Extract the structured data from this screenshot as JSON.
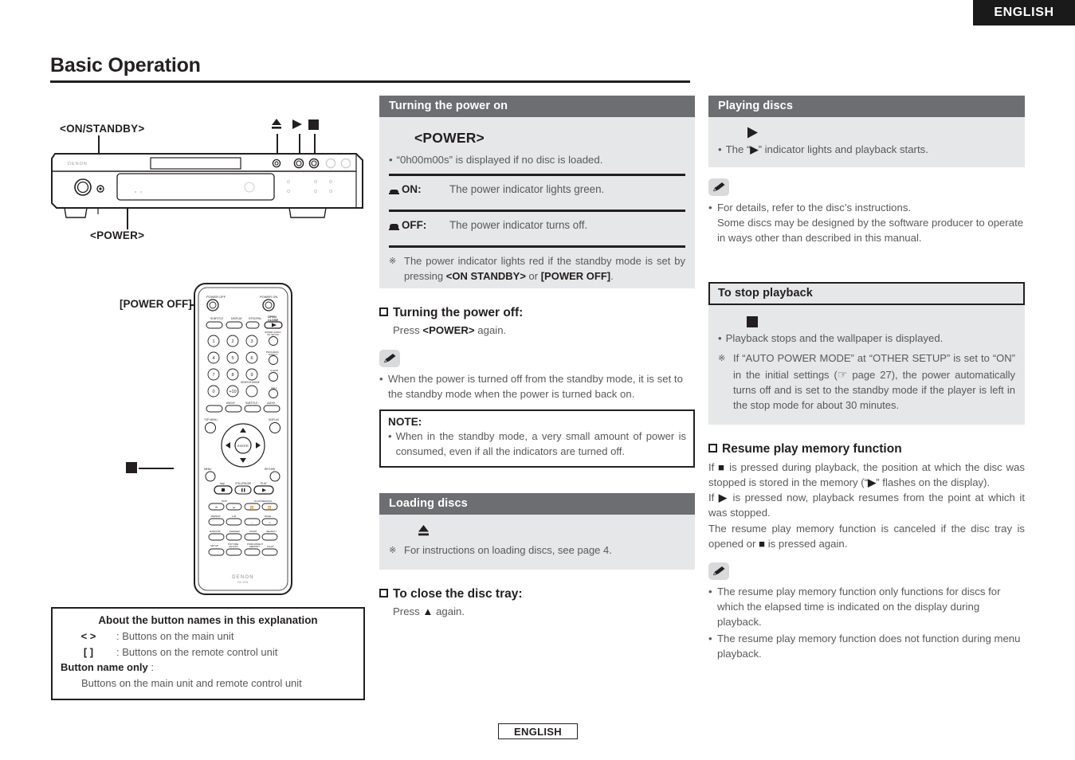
{
  "language_tab": "ENGLISH",
  "footer_tab": "ENGLISH",
  "page_title": "Basic Operation",
  "diagram": {
    "main_unit": {
      "label_on_standby": "<ON/STANDBY>",
      "label_power": "<POWER>",
      "symbol_eject": "eject-icon",
      "symbol_play": "play-icon",
      "symbol_stop": "stop-icon",
      "brand": "DENON"
    },
    "remote": {
      "label_power_off": "[POWER OFF]",
      "label_eject": "eject-icon",
      "label_stop": "stop-icon",
      "label_play": "play-icon",
      "brand": "DENON",
      "model": "RC-1011",
      "top_left_button": "POWER OFF",
      "top_right_button": "POWER ON",
      "row_labels": [
        "SUBTITLE",
        "DISPLAY",
        "NTSC/PAL",
        "OPEN CLOSE"
      ],
      "keypad": [
        "1",
        "2",
        "3",
        "4",
        "5",
        "6",
        "7",
        "8",
        "9",
        "0",
        "+10"
      ],
      "enter_label": "ENTER",
      "transport": [
        "STOP",
        "STILL/PAUSE",
        "PLAY"
      ]
    }
  },
  "middle": {
    "power_on": {
      "header": "Turning the power on",
      "button": "<POWER>",
      "bullet": "“0h00m00s” is displayed if no disc is loaded.",
      "rows": [
        {
          "icon": "button-pressed-icon",
          "key": "ON:",
          "value": "The power indicator lights green."
        },
        {
          "icon": "button-raised-icon",
          "key": "OFF:",
          "value": "The power indicator turns off."
        }
      ],
      "note_pre": "The power indicator lights red if the standby mode is set by pressing ",
      "note_b1": "<ON STANDBY>",
      "note_mid": " or ",
      "note_b2": "[POWER OFF]",
      "note_end": "."
    },
    "power_off": {
      "heading": "Turning the power off:",
      "press_pre": "Press ",
      "press_bold": "<POWER>",
      "press_post": " again.",
      "pencil_note": "When the power is turned off from the standby mode, it is set to the standby mode when the power is turned back on.",
      "note_title": "NOTE:",
      "note_text": "When in the standby mode, a very small amount of power is consumed, even if all the indicators are turned off."
    },
    "loading": {
      "header": "Loading discs",
      "symbol": "eject-icon",
      "note": "For instructions on loading discs, see page 4.",
      "heading": "To close the disc tray:",
      "press_pre": "Press ",
      "press_sym": "▲",
      "press_post": " again."
    }
  },
  "right": {
    "playing": {
      "header": "Playing discs",
      "symbol": "play-icon",
      "bullet_pre": "The “",
      "bullet_sym": "▶",
      "bullet_post": "” indicator lights and playback starts.",
      "pencil_notes": [
        "For details, refer to the disc’s instructions.",
        "Some discs may be designed by the software producer to operate in ways other than described in this manual."
      ]
    },
    "stop": {
      "header": "To stop playback",
      "symbol": "stop-icon",
      "bullet": "Playback stops and the wallpaper is displayed.",
      "note_pre": "If “AUTO POWER MODE” at “OTHER SETUP” is set to “ON” in the initial settings (",
      "note_page": "page 27",
      "note_post": "), the power automatically turns off and is set to the standby mode if the player is left in the stop mode for about 30 minutes."
    },
    "resume": {
      "heading": "Resume play memory function",
      "p1_a": "If ",
      "p1_sym": "■",
      "p1_b": " is pressed during playback, the position at which the disc was stopped is stored in the memory (“",
      "p1_sym2": "▶",
      "p1_c": "” flashes on the display).",
      "p2_a": "If ",
      "p2_sym": "▶",
      "p2_b": " is pressed now, playback resumes from the point at which it was stopped.",
      "p3_a": "The resume play memory function is canceled if the disc tray is opened or ",
      "p3_sym": "■",
      "p3_b": " is pressed again.",
      "pencil_notes": [
        "The resume play memory function only functions for discs for which the elapsed time is indicated on the display during playback.",
        "The resume play memory function does not function during menu playback."
      ]
    }
  },
  "legend": {
    "title": "About the button names in this explanation",
    "rows": [
      {
        "sym": "<    >",
        "desc": ": Buttons on the main unit"
      },
      {
        "sym": "[     ]",
        "desc": ": Buttons on the remote control unit"
      }
    ],
    "key_label": "Button name only",
    "key_colon": ":",
    "key_desc": "Buttons on the main unit and remote control unit"
  }
}
